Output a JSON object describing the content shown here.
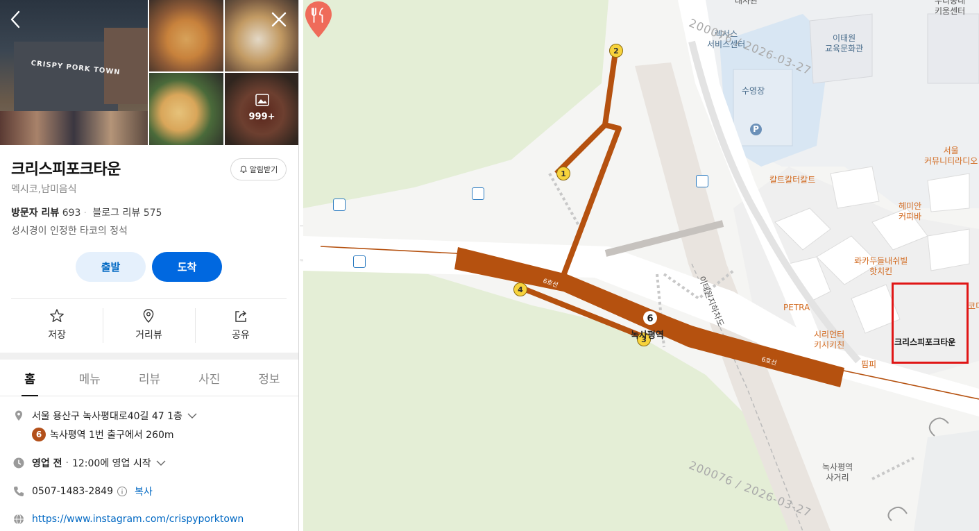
{
  "place": {
    "name": "크리스피포크타운",
    "alarm_label": "알림받기",
    "category": "멕시코,남미음식",
    "visitor_review_label": "방문자 리뷰",
    "visitor_review_count": "693",
    "blog_review_label": "블로그 리뷰",
    "blog_review_count": "575",
    "description": "성시경이 인정한 타코의 정석",
    "photo_count": "999+",
    "sign_text": "CRISPY PORK TOWN"
  },
  "buttons": {
    "depart": "출발",
    "arrive": "도착"
  },
  "actions": [
    {
      "label": "저장",
      "icon": "star-icon"
    },
    {
      "label": "거리뷰",
      "icon": "location-pin-icon"
    },
    {
      "label": "공유",
      "icon": "share-icon"
    }
  ],
  "tabs": [
    {
      "label": "홈",
      "active": true
    },
    {
      "label": "메뉴",
      "active": false
    },
    {
      "label": "리뷰",
      "active": false
    },
    {
      "label": "사진",
      "active": false
    },
    {
      "label": "정보",
      "active": false
    }
  ],
  "info": {
    "address": "서울 용산구 녹사평대로40길 47 1층",
    "subway_line": "6",
    "subway_text": "녹사평역 1번 출구에서 260m",
    "hours_status": "영업 전",
    "hours_text": "12:00에 영업 시작",
    "phone": "0507-1483-2849",
    "copy_label": "복사",
    "website": "https://www.instagram.com/crispyporktown"
  },
  "map": {
    "station_name": "녹사평역",
    "station_line": "6",
    "line_label": "6호선",
    "road_label": "이태원지하차도",
    "pin_label": "크리스피포크타운",
    "exits": [
      "1",
      "2",
      "3",
      "4"
    ],
    "watermark": "200076 / 2026-03-27",
    "labels": {
      "top_cut": "대사관",
      "service_center": "렉서스\n서비스센터",
      "edu_center": "이태원\n교육문화관",
      "pool": "수영장",
      "parking": "P",
      "keum_center": "우리동네\n키움센터",
      "community_radio": "서울\n커뮤니티라디오",
      "cultcult": "칼트칼터칼트",
      "hemian": "헤미안\n커피바",
      "lokakdl": "롸카두들내쉬빌\n핫치킨",
      "petra": "PETRA",
      "syrian": "시리언터\n키시키친",
      "pimpi": "핌피",
      "crossing": "녹사평역\n사거리",
      "code_cut": "코디"
    }
  },
  "colors": {
    "line6": "#b5510f",
    "accent_blue": "#0068e0",
    "park": "#e4eed6",
    "highlight": "#e01616"
  }
}
